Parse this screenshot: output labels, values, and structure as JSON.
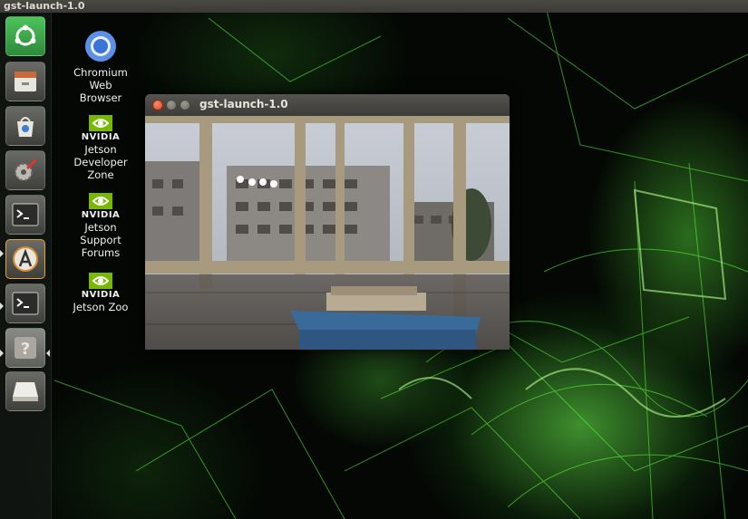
{
  "top_panel": {
    "title": "gst-launch-1.0"
  },
  "desktop_icons": [
    {
      "label": "Chromium\nWeb\nBrowser",
      "icon": "chromium-icon"
    },
    {
      "brand": "NVIDIA",
      "label": "Jetson\nDeveloper\nZone",
      "icon": "nvidia-icon"
    },
    {
      "brand": "NVIDIA",
      "label": "Jetson\nSupport\nForums",
      "icon": "nvidia-icon"
    },
    {
      "brand": "NVIDIA",
      "label": "Jetson Zoo",
      "icon": "nvidia-icon"
    }
  ],
  "launcher": [
    "ubuntu-dash-icon",
    "files-icon",
    "software-center-icon",
    "system-settings-icon",
    "terminal-icon",
    "software-updater-icon",
    "terminal-icon",
    "help-icon",
    "removable-drive-icon"
  ],
  "window": {
    "title": "gst-launch-1.0",
    "content": "camera-preview"
  },
  "colors": {
    "accent": "#df4b1d",
    "wallpaper_glow": "#6eff50",
    "launcher_ubuntu": "#3aa84a"
  }
}
